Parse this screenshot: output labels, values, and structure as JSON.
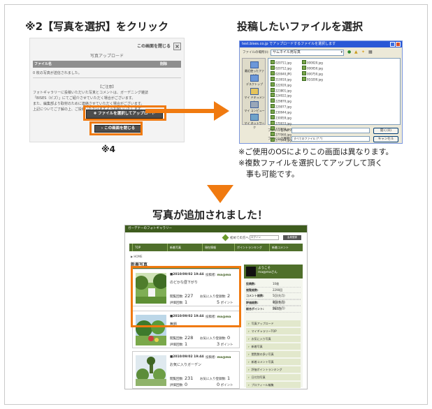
{
  "step1": {
    "title": "※2【写真を選択】をクリック",
    "caption": "※4",
    "dialog": {
      "close_label": "この画面を閉じる",
      "close_icon": "close-icon",
      "title": "写真アップロード",
      "col_filename": "ファイル名",
      "col_delete": "削除",
      "status": "0 枚の写真が送信されました。",
      "notes_heading": "【ご注意】",
      "notes": [
        "フォトギャラリーに投稿いただいた写真とコメントは、ガーデニング雑誌",
        "「BISES（ビズ）」にてご紹介させていただく場合がございます。",
        "また、編集部より取材のために連絡させていただく場合がございます。",
        "上記についてご了解の上、ご投稿いただけますようお願いいたします。"
      ],
      "select_button": "ファイルを選択してアップロード",
      "close_button": "この画面を閉じる"
    }
  },
  "step2": {
    "title": "投稿したいファイルを選択",
    "dialog": {
      "window_title": "test.bises.co.jp でアップロードするファイルを選択します",
      "look_in_label": "ファイルの場所(I):",
      "look_in_value": "サムネイル用写真",
      "places": [
        "最近使ったファイル",
        "デスクトップ",
        "マイ ドキュメント",
        "マイ コンピュータ",
        "マイ ネットワーク"
      ],
      "files_col1": [
        "020711.jpg",
        "020712.jpg",
        "020040.JPG",
        "210010.jpg",
        "222020.jpg",
        "223801.jpg",
        "224022.jpg",
        "229870.jpg",
        "229077.jpg",
        "230044.jpg",
        "230059.jpg",
        "270033.jpg",
        "277038.jpg",
        "277060.jpg",
        "277044.jpg",
        "287750.jpg",
        "287791.jpg"
      ],
      "files_col2": [
        "000020.jpg",
        "000050.jpg",
        "000750.jpg",
        "910200.jpg"
      ],
      "filename_label": "ファイル名(N):",
      "filetype_label": "ファイルの種類(T):",
      "filetype_value": "すべてのファイル (*.*)",
      "open_button": "開く(O)",
      "cancel_button": "キャンセル"
    },
    "notes": [
      "※ご使用のOSによりこの画面は異なります。",
      "※複数ファイルを選択してアップして頂く",
      "　事も可能です。"
    ]
  },
  "step3": {
    "title": "写真が追加されました！",
    "page": {
      "site_title": "ガーデナーのフォトギャラリー",
      "first_visit": "初めての方へ",
      "login_placeholder": "ログイン",
      "login_button": "会員登録",
      "nav": [
        "TOP",
        "新着写真",
        "現在情報",
        "ポイントランキング",
        "新着コメント"
      ],
      "breadcrumb": "▶ HOME",
      "section": "新着写真",
      "cards": [
        {
          "date": "■2010/09/02 19:44",
          "poster_label": "投稿者:",
          "poster": "ma@ma",
          "title": "のどかな昼下がり",
          "views_label": "閲覧回数:",
          "views": "227",
          "evals_label": "評価回数:",
          "evals": "1",
          "favs_label": "お気に入り登録数:",
          "favs": "2",
          "points": "5",
          "points_unit": "ポイント"
        },
        {
          "date": "■2010/09/02 19:44",
          "poster_label": "投稿者:",
          "poster": "ma@ma",
          "title": "無題",
          "views_label": "閲覧回数:",
          "views": "228",
          "evals_label": "評価回数:",
          "evals": "1",
          "favs_label": "お気に入り登録数:",
          "favs": "0",
          "points": "3",
          "points_unit": "ポイント"
        },
        {
          "date": "■2010/09/02 19:44",
          "poster_label": "投稿者:",
          "poster": "ma@ma",
          "title": "お気に入りガーデン",
          "views_label": "閲覧回数:",
          "views": "231",
          "evals_label": "評価回数:",
          "evals": "0",
          "favs_label": "お気に入り登録数:",
          "favs": "1",
          "points": "0",
          "points_unit": "ポイント"
        }
      ],
      "sidebar": {
        "welcome": "ようこそ",
        "user": "ma@maさん",
        "stats": [
          {
            "label": "投稿数:",
            "value": "10枚"
          },
          {
            "label": "閲覧総数:",
            "value": "2290回"
          },
          {
            "label": "コメント総数:",
            "value": "5回(先月)"
          },
          {
            "label": "",
            "value": "0回(今月)"
          },
          {
            "label": "評価総数:",
            "value": "4回(先月)"
          },
          {
            "label": "",
            "value": "0回(今月)"
          },
          {
            "label": "総合ポイント:",
            "value": "29.5点"
          }
        ],
        "menu": [
          "写真アップロード",
          "マイギャラリーTOP",
          "お気に入り写真",
          "新着写真",
          "閲覧数の多い写真",
          "新着コメント写真",
          "評価ポイントランキング",
          "日付別写真",
          "プロフィール編集"
        ]
      }
    }
  },
  "colors": {
    "accent": "#f07a10",
    "site_green": "#4f6f2b"
  }
}
